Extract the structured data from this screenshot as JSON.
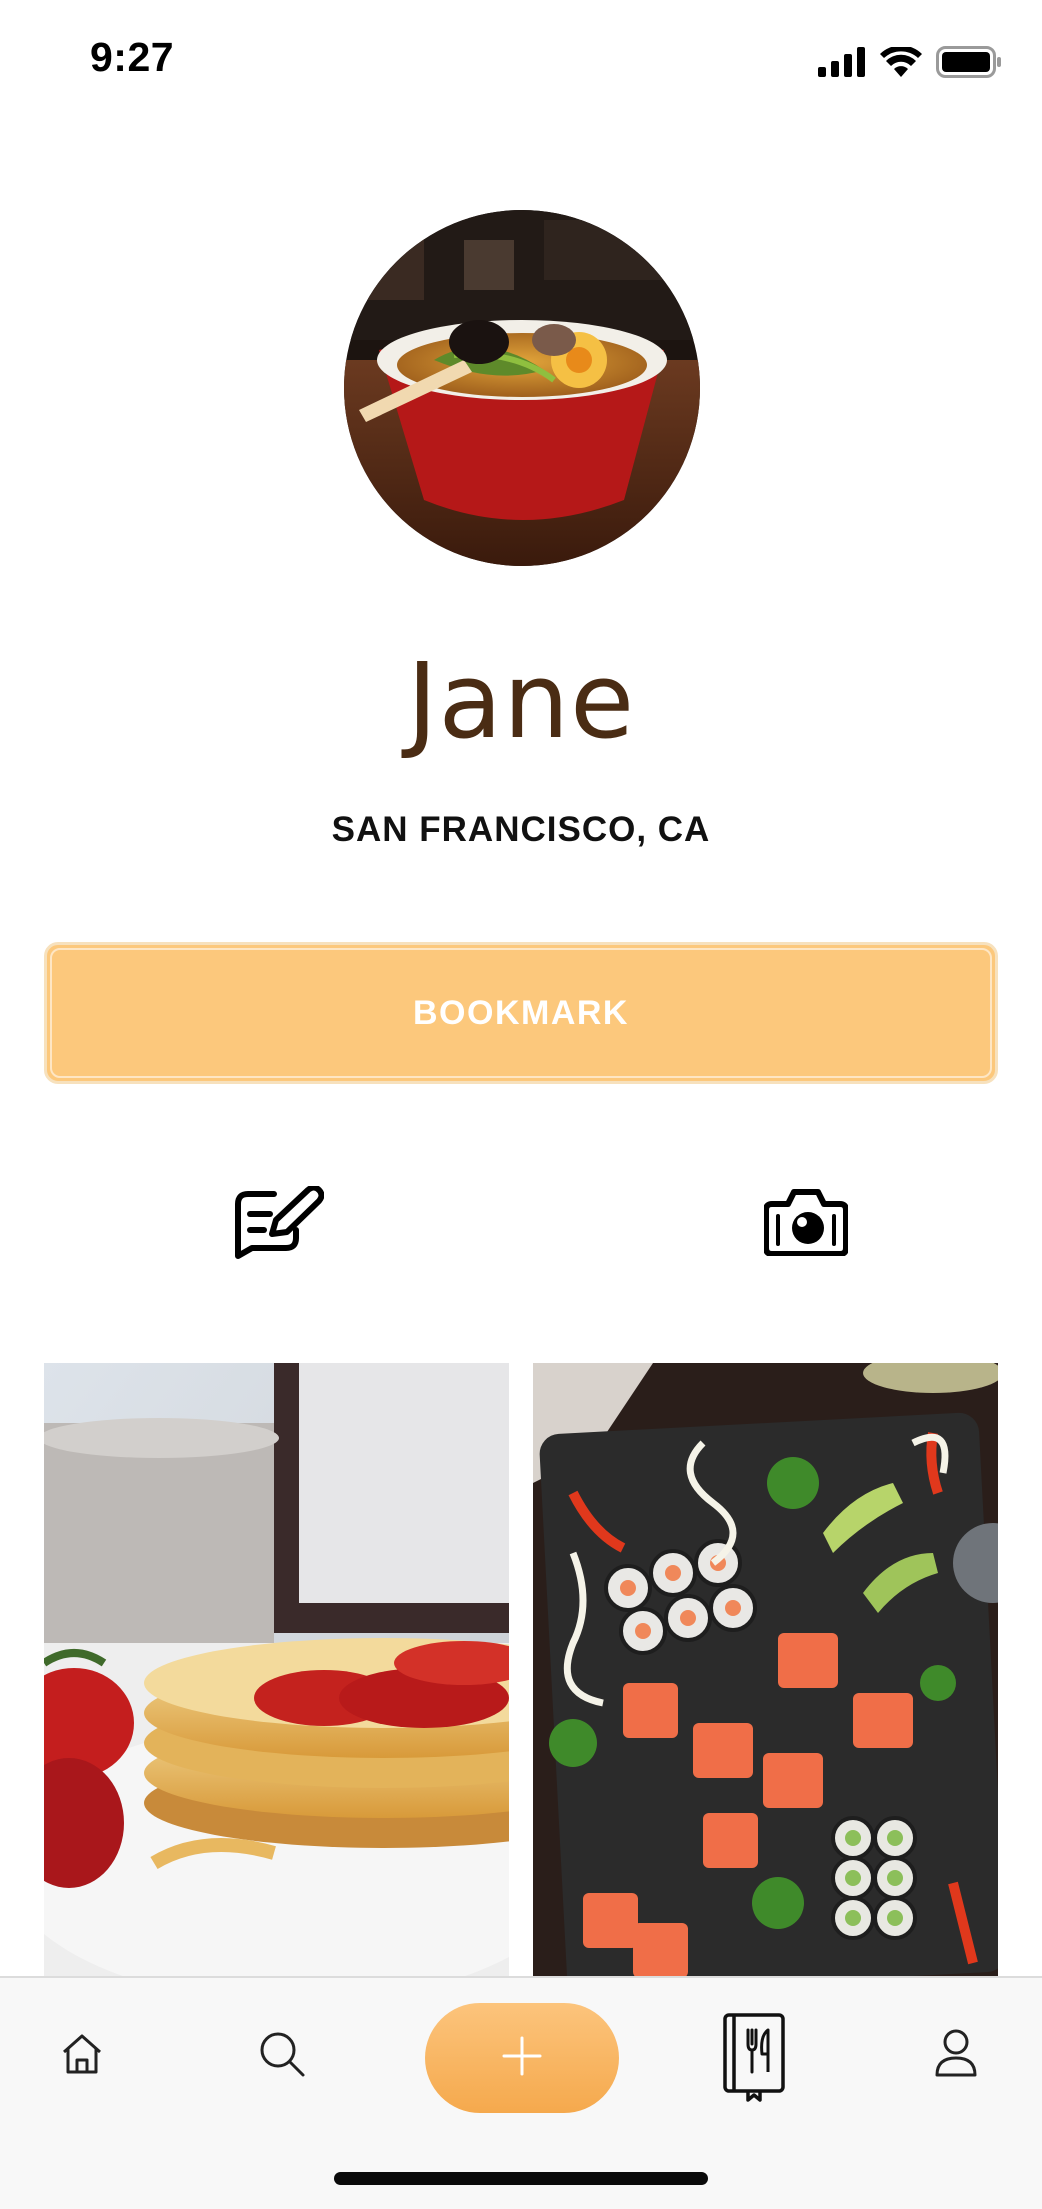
{
  "status_bar": {
    "time": "9:27",
    "icons": [
      "cellular-signal-icon",
      "wifi-icon",
      "battery-icon"
    ]
  },
  "profile": {
    "avatar_image": "ramen bowl photo",
    "name": "Jane",
    "location": "SAN FRANCISCO, CA"
  },
  "bookmark_button": {
    "label": "BOOKMARK",
    "color": "#fcc87c"
  },
  "actions": [
    {
      "name": "write-review",
      "icon": "edit-note-icon"
    },
    {
      "name": "food-camera",
      "icon": "camera-utensils-icon"
    }
  ],
  "photos": [
    {
      "subject": "pancakes with strawberries"
    },
    {
      "subject": "sushi platter"
    }
  ],
  "tab_bar": {
    "items": [
      {
        "name": "home",
        "icon": "home-icon"
      },
      {
        "name": "search",
        "icon": "search-icon"
      },
      {
        "name": "add",
        "icon": "plus-icon"
      },
      {
        "name": "recipe-book",
        "icon": "recipe-book-icon",
        "selected": true
      },
      {
        "name": "profile",
        "icon": "user-icon"
      }
    ],
    "accent": "#f5a94d"
  }
}
